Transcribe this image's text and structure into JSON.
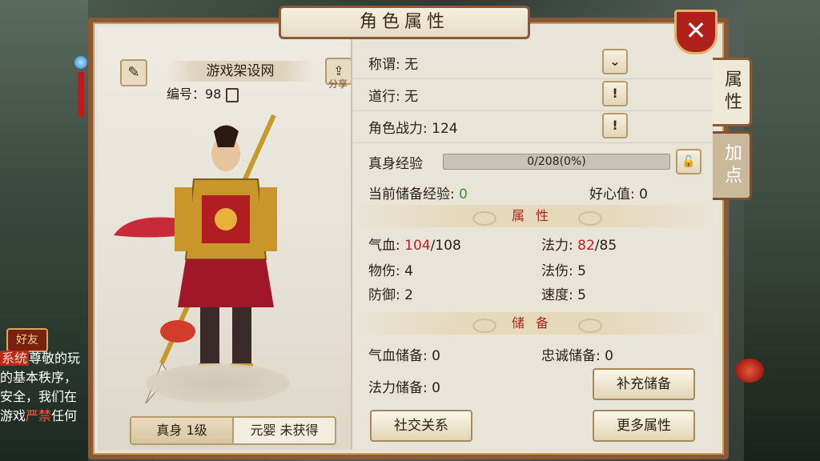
{
  "window": {
    "title": "角色属性",
    "close_label": "✕"
  },
  "side_tabs": [
    {
      "label": "属性",
      "active": true
    },
    {
      "label": "加点",
      "active": false
    }
  ],
  "character": {
    "name": "游戏架设网",
    "id_label": "编号：",
    "id_value": "98",
    "share_label": "分享",
    "bottom_tabs": [
      {
        "label": "真身 1级",
        "active": true
      },
      {
        "label": "元婴 未获得",
        "active": false
      }
    ]
  },
  "info": {
    "title_row": {
      "label": "称谓: 无"
    },
    "dao_row": {
      "label": "道行: 无"
    },
    "power_row": {
      "label": "角色战力: 124"
    },
    "exp": {
      "label": "真身经验",
      "text": "0/208(0%)",
      "progress": 0
    },
    "stored_exp_label": "当前储备经验: ",
    "stored_exp_value": "0",
    "kindness": "好心值: 0"
  },
  "attributes": {
    "section_title": "属性",
    "hp_label": "气血: ",
    "hp_current": "104",
    "hp_max": "/108",
    "mp_label": "法力: ",
    "mp_current": "82",
    "mp_max": "/85",
    "phys_attack": "物伤: 4",
    "magic_attack": "法伤: 5",
    "defense": "防御: 2",
    "speed": "速度: 5"
  },
  "reserves": {
    "section_title": "储备",
    "hp_reserve": "气血储备: 0",
    "loyalty_reserve": "忠诚储备: 0",
    "mp_reserve": "法力储备: 0",
    "refill_button": "补充储备"
  },
  "buttons": {
    "social": "社交关系",
    "more": "更多属性"
  },
  "chat": {
    "friend_badge": "好友",
    "lines": [
      {
        "tag": "系统",
        "text": "尊敬的玩"
      },
      {
        "text": "的基本秩序，"
      },
      {
        "text": "安全，我们在"
      },
      {
        "prefix": "游戏",
        "red": "严禁",
        "suffix": "任何"
      }
    ]
  },
  "colors": {
    "frame": "#8a5a36",
    "panel_bg": "#e9e4d8",
    "accent_red": "#b2201b",
    "value_green": "#2e9a2a"
  }
}
